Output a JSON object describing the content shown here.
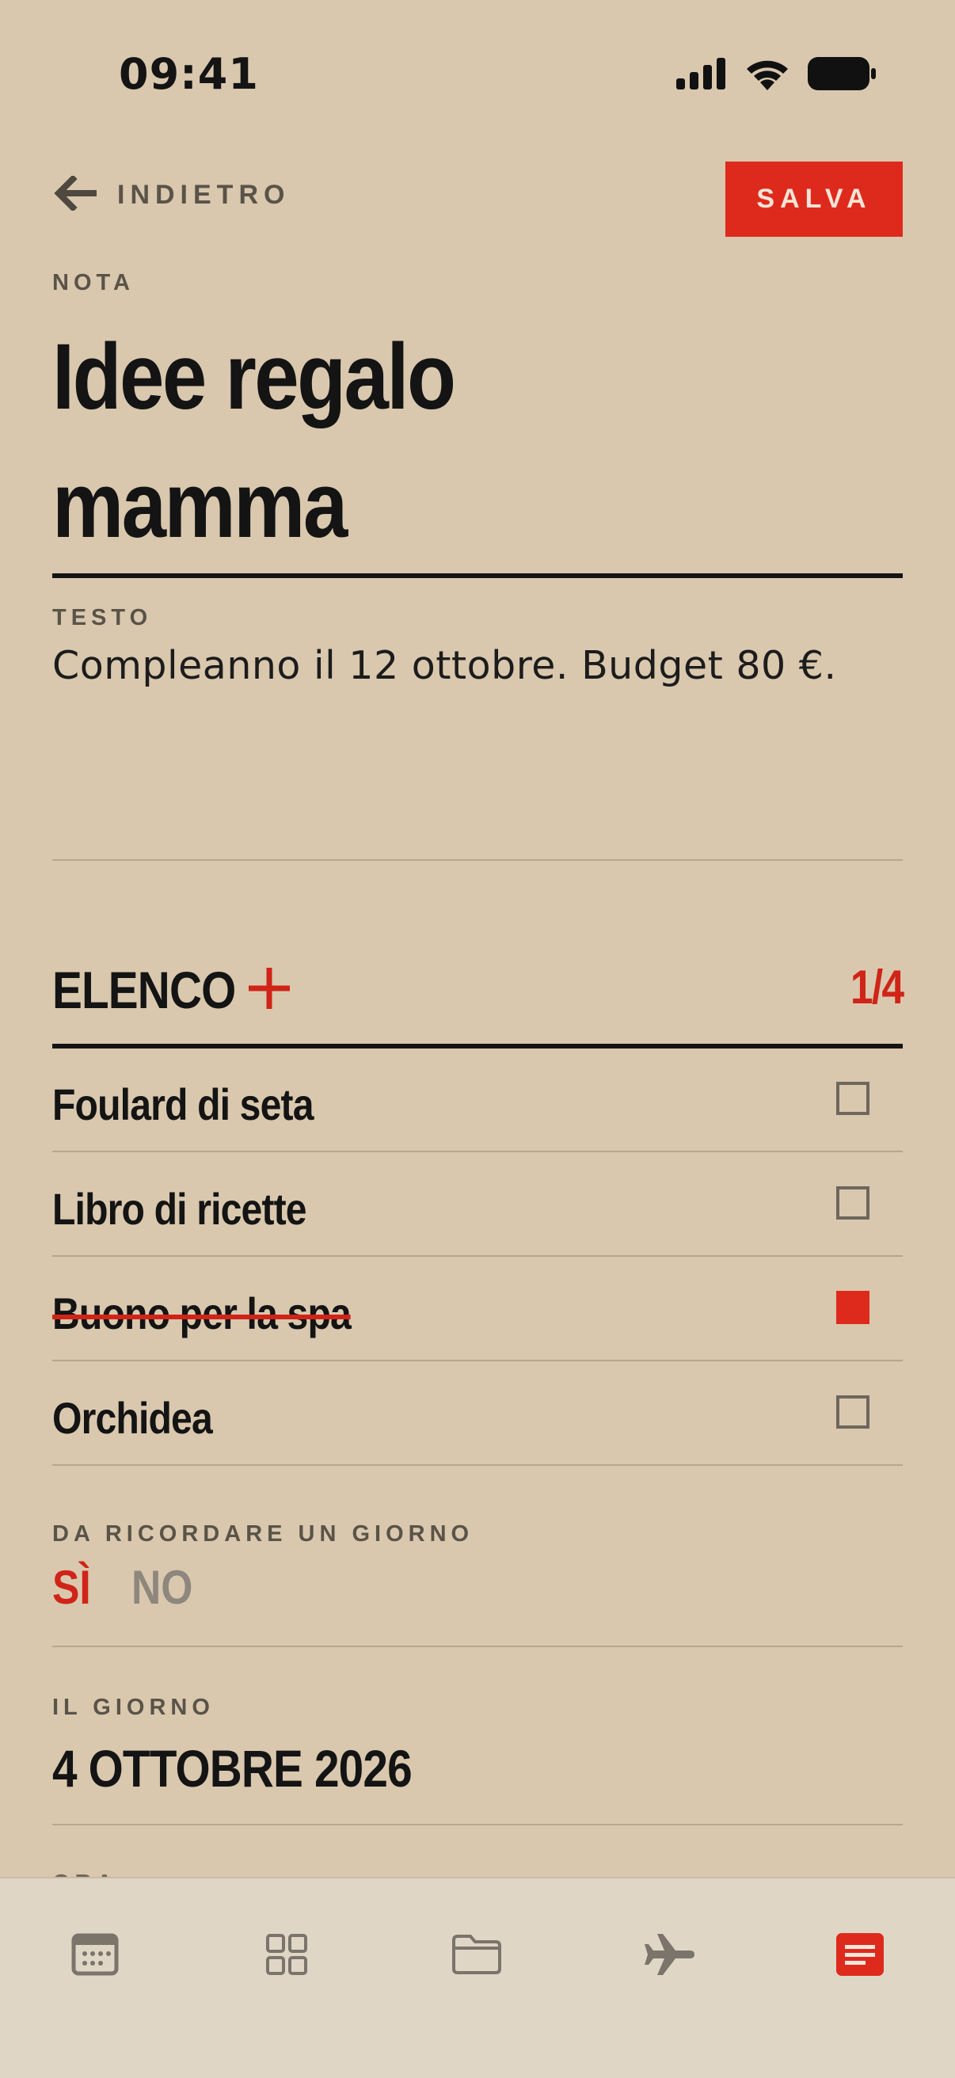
{
  "status_bar": {
    "time": "09:41",
    "icons": [
      "signal-icon",
      "wifi-icon",
      "battery-icon"
    ]
  },
  "nav": {
    "back_label": "INDIETRO",
    "save_label": "SALVA"
  },
  "note": {
    "section_label": "NOTA",
    "title_line1": "Idee regalo",
    "title_line2": "mamma",
    "text_label": "TESTO",
    "text_value": "Compleanno il 12 ottobre. Budget 80 €."
  },
  "list": {
    "heading": "ELENCO",
    "counter": "1/4",
    "items": [
      {
        "label": "Foulard di seta",
        "checked": false
      },
      {
        "label": "Libro di ricette",
        "checked": false
      },
      {
        "label": "Buono per la spa",
        "checked": true
      },
      {
        "label": "Orchidea",
        "checked": false
      }
    ]
  },
  "reminder": {
    "label": "DA RICORDARE UN GIORNO",
    "yes": "SÌ",
    "no": "NO",
    "selected": "yes"
  },
  "date": {
    "label": "IL GIORNO",
    "value": "4 OTTOBRE 2026"
  },
  "next_label_partial": "ORA",
  "tabs": [
    {
      "icon": "calendar-icon",
      "active": false
    },
    {
      "icon": "grid-icon",
      "active": false
    },
    {
      "icon": "folder-icon",
      "active": false
    },
    {
      "icon": "airplane-icon",
      "active": false
    },
    {
      "icon": "notes-icon",
      "active": true
    }
  ],
  "colors": {
    "background": "#d9c8ae",
    "accent": "#de2a1c",
    "text": "#141414",
    "muted": "#5a5348",
    "tabbar": "#dfd6c6"
  }
}
